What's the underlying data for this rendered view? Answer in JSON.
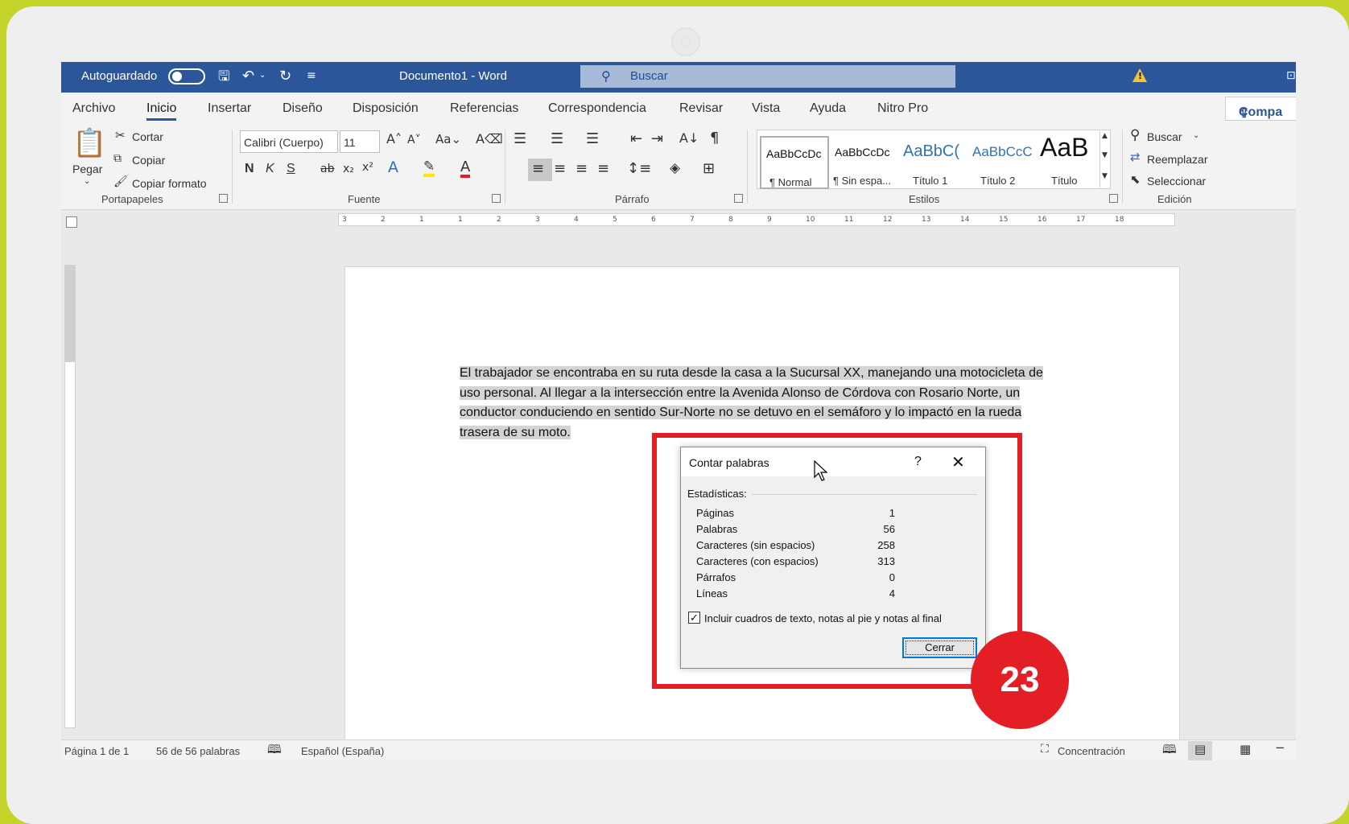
{
  "titlebar": {
    "autosave_label": "Autoguardado",
    "doc_title": "Documento1  -  Word",
    "search_placeholder": "Buscar",
    "warning_icon": "warning-icon"
  },
  "menu": {
    "tabs": [
      "Archivo",
      "Inicio",
      "Insertar",
      "Diseño",
      "Disposición",
      "Referencias",
      "Correspondencia",
      "Revisar",
      "Vista",
      "Ayuda",
      "Nitro Pro"
    ],
    "active": "Inicio",
    "share_label": "Compa"
  },
  "ribbon": {
    "portapapeles": {
      "label": "Portapapeles",
      "paste": "Pegar",
      "cut": "Cortar",
      "copy": "Copiar",
      "format_painter": "Copiar formato"
    },
    "fuente": {
      "label": "Fuente",
      "font_name": "Calibri (Cuerpo)",
      "font_size": "11",
      "bold": "N",
      "italic": "K",
      "underline": "S"
    },
    "parrafo": {
      "label": "Párrafo"
    },
    "estilos": {
      "label": "Estilos",
      "tiles": [
        {
          "preview": "AaBbCcDc",
          "name": "¶ Normal"
        },
        {
          "preview": "AaBbCcDc",
          "name": "¶ Sin espa..."
        },
        {
          "preview": "AaBbC(",
          "name": "Título 1"
        },
        {
          "preview": "AaBbCcC",
          "name": "Título 2"
        },
        {
          "preview": "AaB",
          "name": "Título"
        }
      ]
    },
    "edicion": {
      "label": "Edición",
      "find": "Buscar",
      "replace": "Reemplazar",
      "select": "Seleccionar"
    }
  },
  "ruler": {
    "marks": [
      "3",
      "2",
      "1",
      "1",
      "2",
      "3",
      "4",
      "5",
      "6",
      "7",
      "8",
      "9",
      "10",
      "11",
      "12",
      "13",
      "14",
      "15",
      "16",
      "17",
      "18"
    ]
  },
  "document": {
    "text": "El trabajador se encontraba en su ruta desde la casa a la Sucursal XX, manejando una motocicleta de uso personal. Al llegar a la intersección entre la Avenida Alonso de Córdova con Rosario Norte, un conductor conduciendo en sentido Sur-Norte no se detuvo en el semáforo y lo impactó en la rueda trasera de su moto."
  },
  "dialog": {
    "title": "Contar palabras",
    "help": "?",
    "section": "Estadísticas:",
    "stats": [
      {
        "label": "Páginas",
        "value": "1"
      },
      {
        "label": "Palabras",
        "value": "56"
      },
      {
        "label": "Caracteres (sin espacios)",
        "value": "258"
      },
      {
        "label": "Caracteres (con espacios)",
        "value": "313"
      },
      {
        "label": "Párrafos",
        "value": "0"
      },
      {
        "label": "Líneas",
        "value": "4"
      }
    ],
    "checkbox_label": "Incluir cuadros de texto, notas al pie y notas al final",
    "checkbox_checked": true,
    "close_button": "Cerrar"
  },
  "statusbar": {
    "page": "Página 1 de 1",
    "words": "56 de 56 palabras",
    "language": "Español (España)",
    "focus": "Concentración"
  },
  "annotation": {
    "step_number": "23",
    "color": "#e41e25"
  },
  "colors": {
    "word_blue": "#2b579a",
    "frame_green": "#c5d42a"
  }
}
